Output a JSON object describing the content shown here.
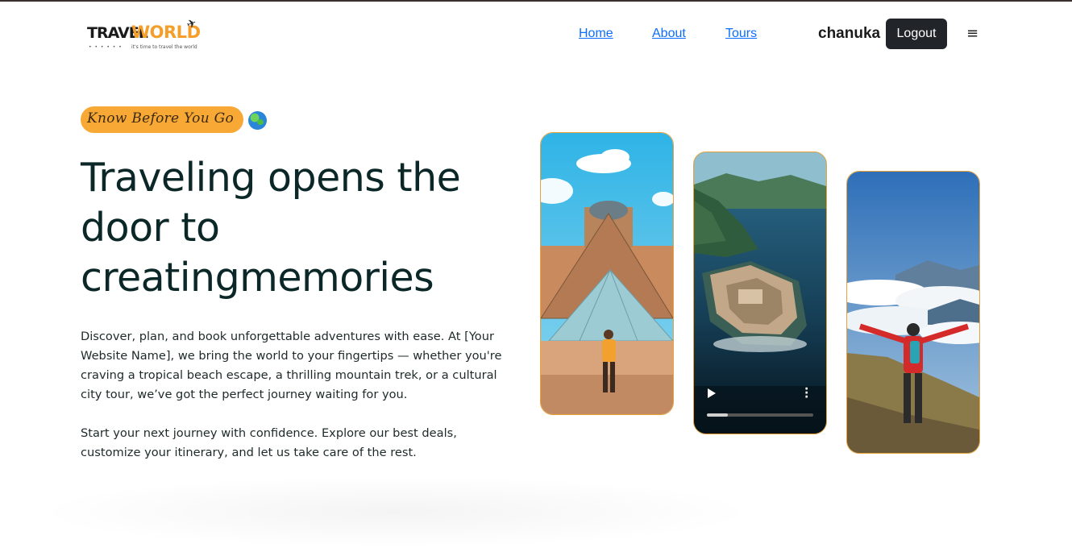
{
  "header": {
    "logo": {
      "word1": "TRAVEL",
      "word2": "WORLD",
      "tagline": "it's time to travel the world",
      "icon": "plane-icon"
    },
    "nav": [
      {
        "label": "Home"
      },
      {
        "label": "About"
      },
      {
        "label": "Tours"
      }
    ],
    "username": "chanuka",
    "logout_label": "Logout",
    "menu_icon": "≡"
  },
  "hero": {
    "badge": "Know Before You Go",
    "badge_icon": "globe-icon",
    "title": "Traveling opens the door to creatingmemories",
    "paragraph1": "Discover, plan, and book unforgettable adventures with ease. At [Your Website Name], we bring the world to your fingertips — whether you're craving a tropical beach escape, a thrilling mountain trek, or a cultural city tour, we’ve got the perfect journey waiting for you.",
    "paragraph2": "Start your next journey with confidence. Explore our best deals, customize your itinerary, and let us take care of the rest."
  },
  "media": {
    "cards": [
      {
        "type": "image",
        "subject": "louvre-pyramid"
      },
      {
        "type": "video",
        "subject": "island-fortress",
        "progress": 0.2
      },
      {
        "type": "image",
        "subject": "mountain-hiker"
      }
    ]
  },
  "colors": {
    "accent": "#f8a834",
    "nav_link": "#0d6efd",
    "dark_button": "#212529",
    "card_border": "#e8a33b"
  }
}
